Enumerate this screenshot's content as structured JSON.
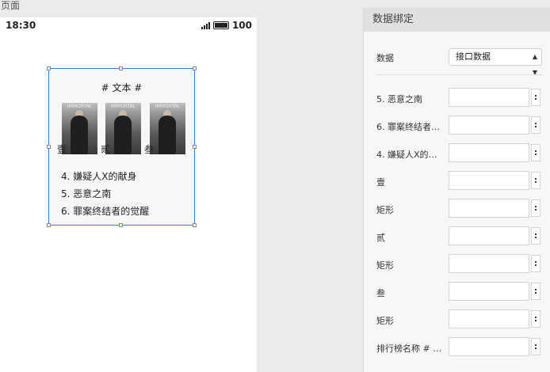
{
  "page_label": "页面",
  "status_bar": {
    "time": "18:30",
    "battery": "100"
  },
  "component": {
    "title": "# 文本 #",
    "posters": [
      {
        "label": "壹",
        "text": "IMMORTAL"
      },
      {
        "label": "贰",
        "text": "IMMORTAL"
      },
      {
        "label": "叁",
        "text": "IMMORTAL"
      }
    ],
    "lines": [
      "4. 嫌疑人X的献身",
      "5. 恶意之南",
      "6. 罪案终结者的觉醒"
    ]
  },
  "panel": {
    "title": "数据绑定",
    "data_label": "数据",
    "data_source": "接口数据",
    "rows": [
      {
        "label": "5. 恶意之南"
      },
      {
        "label": "6. 罪案终结者…"
      },
      {
        "label": "4. 嫌疑人X的…"
      },
      {
        "label": "壹"
      },
      {
        "label": "矩形"
      },
      {
        "label": "贰"
      },
      {
        "label": "矩形"
      },
      {
        "label": "叁"
      },
      {
        "label": "矩形"
      },
      {
        "label": "排行榜名称 # …"
      }
    ],
    "more_glyph": ":"
  }
}
